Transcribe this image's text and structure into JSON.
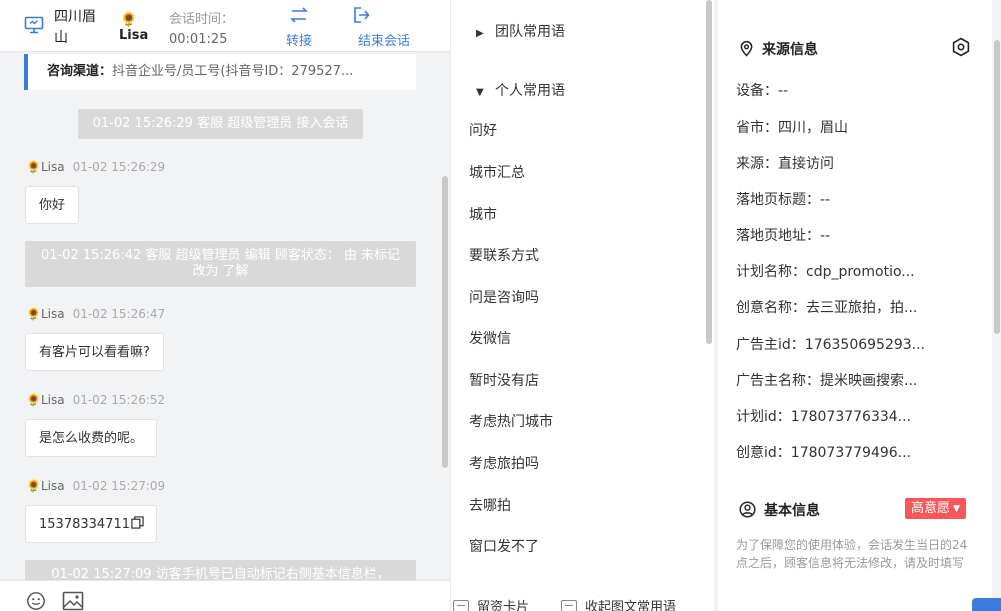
{
  "header": {
    "location": "四川眉山",
    "agent_name": "Lisa",
    "time_label": "会话时间：",
    "time_value": "00:01:25",
    "transfer_label": "转接",
    "end_label": "结束会话"
  },
  "channel": {
    "label": "咨询渠道：",
    "value": "抖音企业号/员工号(抖音号ID：279527..."
  },
  "messages": [
    {
      "type": "system",
      "text": "01-02 15:26:29 客服 超级管理员 接入会话"
    },
    {
      "type": "meta",
      "sender": "Lisa",
      "time": "01-02 15:26:29"
    },
    {
      "type": "bubble",
      "text": "你好"
    },
    {
      "type": "system",
      "text": "01-02 15:26:42 客服 超级管理员 编辑 顾客状态： 由 未标记 改为 了解"
    },
    {
      "type": "meta",
      "sender": "Lisa",
      "time": "01-02 15:26:47"
    },
    {
      "type": "bubble",
      "text": "有客片可以看看嘛?"
    },
    {
      "type": "meta",
      "sender": "Lisa",
      "time": "01-02 15:26:52"
    },
    {
      "type": "bubble",
      "text": "是怎么收费的呢。"
    },
    {
      "type": "meta",
      "sender": "Lisa",
      "time": "01-02 15:27:09"
    },
    {
      "type": "bubble",
      "text": "15378334711"
    },
    {
      "type": "system",
      "text": "01-02 15:27:09 访客手机号已自动标记右侧基本信息栏，"
    }
  ],
  "phrases": {
    "team_title": "团队常用语",
    "personal_title": "个人常用语",
    "items": [
      "问好",
      "城市汇总",
      "城市",
      "要联系方式",
      "问是咨询吗",
      "发微信",
      "暂时没有店",
      "考虑热门城市",
      "考虑旅拍吗",
      "去哪拍",
      "窗口发不了"
    ],
    "footer_card": "留资卡片",
    "footer_collapse": "收起图文常用语"
  },
  "source_info": {
    "title": "来源信息",
    "rows": [
      {
        "key": "设备：",
        "value": "--"
      },
      {
        "key": "省市：",
        "value": "四川，眉山"
      },
      {
        "key": "来源：",
        "value": "直接访问"
      },
      {
        "key": "落地页标题：",
        "value": "--"
      },
      {
        "key": "落地页地址：",
        "value": "--"
      },
      {
        "key": "计划名称：",
        "value": "cdp_promotio..."
      },
      {
        "key": "创意名称：",
        "value": "去三亚旅拍，拍..."
      },
      {
        "key": "广告主id：",
        "value": "176350695293..."
      },
      {
        "key": "广告主名称：",
        "value": "提米映画搜索..."
      },
      {
        "key": "计划id：",
        "value": "178073776334..."
      },
      {
        "key": "创意id：",
        "value": "178073779496..."
      }
    ]
  },
  "basic_info": {
    "title": "基本信息",
    "intent_badge": "高意愿",
    "notice": "为了保障您的使用体验，会话发生当日的24点之后，顾客信息将无法修改，请及时填写"
  },
  "colors": {
    "accent": "#3a7cdb",
    "badge": "#f5575a",
    "panel_bg": "#f2f3f5"
  }
}
